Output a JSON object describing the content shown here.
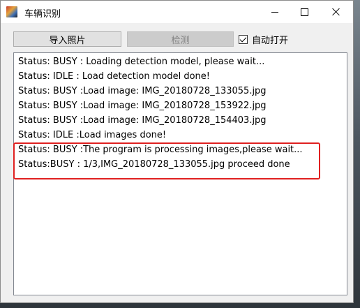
{
  "window": {
    "title": "车辆识别"
  },
  "toolbar": {
    "import_label": "导入照片",
    "detect_label": "检测",
    "auto_open_label": "自动打开",
    "auto_open_checked": true
  },
  "log": {
    "lines": [
      "Status: BUSY : Loading detection model, please wait...",
      "Status: IDLE : Load detection model done!",
      "Status: BUSY :Load image: IMG_20180728_133055.jpg",
      "Status: BUSY :Load image: IMG_20180728_153922.jpg",
      "Status: BUSY :Load image: IMG_20180728_154403.jpg",
      "Status: IDLE :Load images done!",
      "Status: BUSY :The program is processing images,please wait...",
      "Status:BUSY : 1/3,IMG_20180728_133055.jpg proceed done"
    ]
  },
  "colors": {
    "highlight": "#e02020"
  }
}
